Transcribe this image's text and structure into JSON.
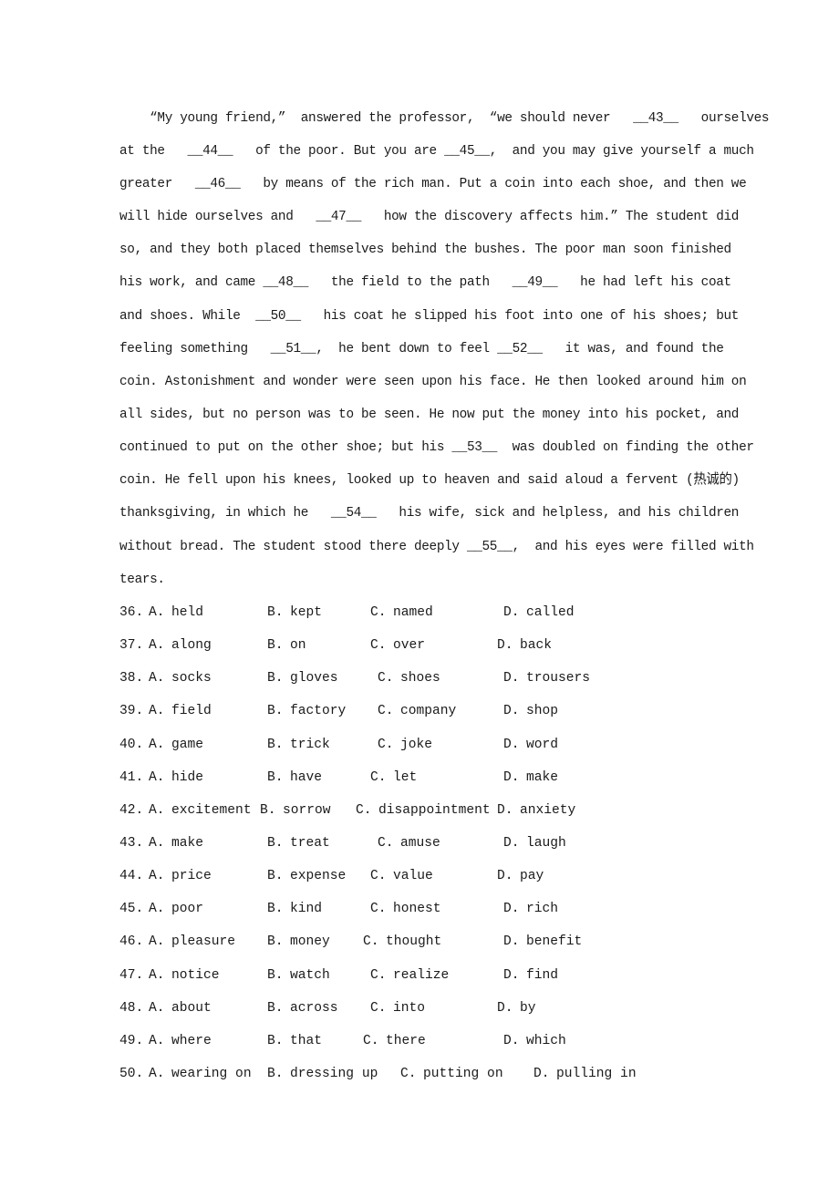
{
  "passage": {
    "lines": [
      "    “My young friend,”  answered the professor,  “we should never   __43__   ourselves",
      "at the   __44__   of the poor. But you are __45__,  and you may give yourself a much",
      "greater   __46__   by means of the rich man. Put a coin into each shoe, and then we",
      "will hide ourselves and   __47__   how the discovery affects him.” The student did",
      "so, and they both placed themselves behind the bushes. The poor man soon finished",
      "his work, and came __48__   the field to the path   __49__   he had left his coat",
      "and shoes. While  __50__   his coat he slipped his foot into one of his shoes; but",
      "feeling something   __51__,  he bent down to feel __52__   it was, and found the",
      "coin. Astonishment and wonder were seen upon his face. He then looked around him on",
      "all sides, but no person was to be seen. He now put the money into his pocket, and",
      "continued to put on the other shoe; but his __53__  was doubled on finding the other",
      "coin. He fell upon his knees, looked up to heaven and said aloud a fervent (热诚的)",
      "thanksgiving, in which he   __54__   his wife, sick and helpless, and his children",
      "without bread. The student stood there deeply __55__,  and his eyes were filled with",
      "tears."
    ]
  },
  "questions": [
    {
      "number": "36.",
      "options": [
        {
          "letter": "A.",
          "text": "held"
        },
        {
          "letter": "B.",
          "text": "kept"
        },
        {
          "letter": "C.",
          "text": "named"
        },
        {
          "letter": "D.",
          "text": "called"
        }
      ]
    },
    {
      "number": "37.",
      "options": [
        {
          "letter": "A.",
          "text": "along"
        },
        {
          "letter": "B.",
          "text": "on"
        },
        {
          "letter": "C.",
          "text": "over"
        },
        {
          "letter": "D.",
          "text": "back"
        }
      ]
    },
    {
      "number": "38.",
      "options": [
        {
          "letter": "A.",
          "text": "socks"
        },
        {
          "letter": "B.",
          "text": "gloves"
        },
        {
          "letter": "C.",
          "text": "shoes"
        },
        {
          "letter": "D.",
          "text": "trousers"
        }
      ]
    },
    {
      "number": "39.",
      "options": [
        {
          "letter": "A.",
          "text": "field"
        },
        {
          "letter": "B.",
          "text": "factory"
        },
        {
          "letter": "C.",
          "text": "company"
        },
        {
          "letter": "D.",
          "text": "shop"
        }
      ]
    },
    {
      "number": "40.",
      "options": [
        {
          "letter": "A.",
          "text": "game"
        },
        {
          "letter": "B.",
          "text": "trick"
        },
        {
          "letter": "C.",
          "text": "joke"
        },
        {
          "letter": "D.",
          "text": "word"
        }
      ]
    },
    {
      "number": "41.",
      "options": [
        {
          "letter": "A.",
          "text": "hide"
        },
        {
          "letter": "B.",
          "text": "have"
        },
        {
          "letter": "C.",
          "text": "let"
        },
        {
          "letter": "D.",
          "text": "make"
        }
      ]
    },
    {
      "number": "42.",
      "options": [
        {
          "letter": "A.",
          "text": "excitement"
        },
        {
          "letter": "B.",
          "text": "sorrow"
        },
        {
          "letter": "C.",
          "text": "disappointment"
        },
        {
          "letter": "D.",
          "text": "anxiety"
        }
      ]
    },
    {
      "number": "43.",
      "options": [
        {
          "letter": "A.",
          "text": "make"
        },
        {
          "letter": "B.",
          "text": "treat"
        },
        {
          "letter": "C.",
          "text": "amuse"
        },
        {
          "letter": "D.",
          "text": "laugh"
        }
      ]
    },
    {
      "number": "44.",
      "options": [
        {
          "letter": "A.",
          "text": "price"
        },
        {
          "letter": "B.",
          "text": "expense"
        },
        {
          "letter": "C.",
          "text": "value"
        },
        {
          "letter": "D.",
          "text": "pay"
        }
      ]
    },
    {
      "number": "45.",
      "options": [
        {
          "letter": "A.",
          "text": "poor"
        },
        {
          "letter": "B.",
          "text": "kind"
        },
        {
          "letter": "C.",
          "text": "honest"
        },
        {
          "letter": "D.",
          "text": "rich"
        }
      ]
    },
    {
      "number": "46.",
      "options": [
        {
          "letter": "A.",
          "text": "pleasure"
        },
        {
          "letter": "B.",
          "text": "money"
        },
        {
          "letter": "C.",
          "text": "thought"
        },
        {
          "letter": "D.",
          "text": "benefit"
        }
      ]
    },
    {
      "number": "47.",
      "options": [
        {
          "letter": "A.",
          "text": "notice"
        },
        {
          "letter": "B.",
          "text": "watch"
        },
        {
          "letter": "C.",
          "text": "realize"
        },
        {
          "letter": "D.",
          "text": "find"
        }
      ]
    },
    {
      "number": "48.",
      "options": [
        {
          "letter": "A.",
          "text": "about"
        },
        {
          "letter": "B.",
          "text": "across"
        },
        {
          "letter": "C.",
          "text": "into"
        },
        {
          "letter": "D.",
          "text": "by"
        }
      ]
    },
    {
      "number": "49.",
      "options": [
        {
          "letter": "A.",
          "text": "where"
        },
        {
          "letter": "B.",
          "text": "that"
        },
        {
          "letter": "C.",
          "text": "there"
        },
        {
          "letter": "D.",
          "text": "which"
        }
      ]
    },
    {
      "number": "50.",
      "options": [
        {
          "letter": "A.",
          "text": "wearing on"
        },
        {
          "letter": "B.",
          "text": "dressing up"
        },
        {
          "letter": "C.",
          "text": "putting on"
        },
        {
          "letter": "D.",
          "text": "pulling in"
        }
      ]
    }
  ]
}
